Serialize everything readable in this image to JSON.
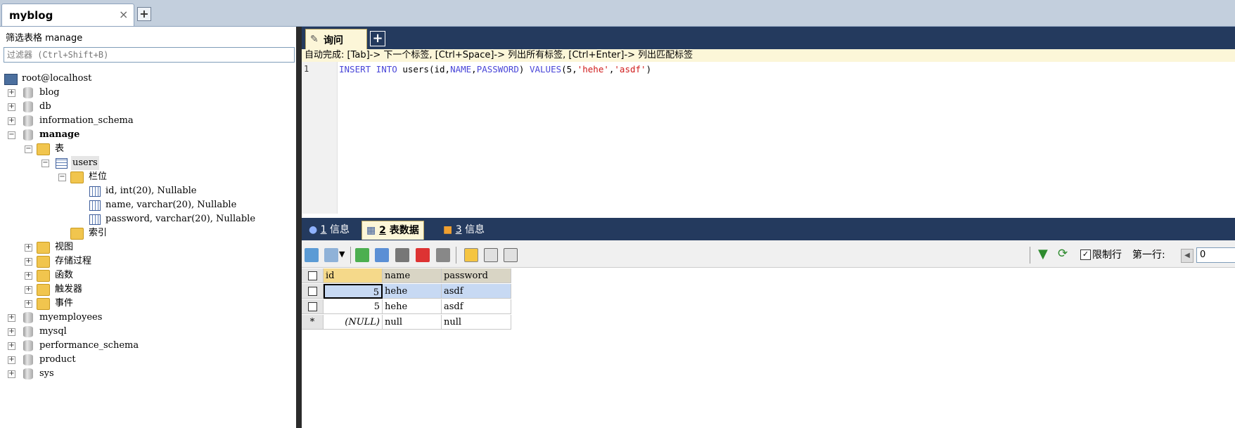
{
  "window": {
    "doc_tab": {
      "label": "myblog",
      "close": "×"
    },
    "new_tab": "+"
  },
  "left_panel": {
    "filter_label": "筛选表格 manage",
    "filter_placeholder": "过滤器 (Ctrl+Shift+B)",
    "host": "root@localhost",
    "databases": [
      "blog",
      "db",
      "information_schema"
    ],
    "active_db": "manage",
    "tables_folder": "表",
    "table": "users",
    "columns_folder": "栏位",
    "columns": [
      "id, int(20), Nullable",
      "name, varchar(20), Nullable",
      "password, varchar(20), Nullable"
    ],
    "index_folder": "索引",
    "other_folders": [
      "视图",
      "存储过程",
      "函数",
      "触发器",
      "事件"
    ],
    "more_databases": [
      "myemployees",
      "mysql",
      "performance_schema",
      "product",
      "sys"
    ]
  },
  "query": {
    "tab_label": "询问",
    "new_tab": "+",
    "autocomplete_hint": "自动完成: [Tab]-> 下一个标签, [Ctrl+Space]-> 列出所有标签, [Ctrl+Enter]-> 列出匹配标签",
    "line_number": "1",
    "sql": {
      "kw1": "INSERT INTO",
      "t1": " users(id,",
      "kw2": "NAME",
      "t2": ",",
      "kw3": "PASSWORD",
      "t3": ") ",
      "kw4": "VALUES",
      "t4": "(5,",
      "s1": "'hehe'",
      "t5": ",",
      "s2": "'asdf'",
      "t6": ")"
    }
  },
  "result_tabs": [
    {
      "num": "1",
      "label": "信息"
    },
    {
      "num": "2",
      "label": "表数据"
    },
    {
      "num": "3",
      "label": "信息"
    }
  ],
  "toolbar": {
    "limit_rows_label": "限制行",
    "limit_checked": "✓",
    "first_row_label": "第一行:",
    "first_row_value": "0"
  },
  "grid": {
    "headers": [
      "id",
      "name",
      "password"
    ],
    "rows": [
      [
        "5",
        "hehe",
        "asdf"
      ],
      [
        "5",
        "hehe",
        "asdf"
      ],
      [
        "(NULL)",
        "null",
        "null"
      ]
    ],
    "new_row_marker": "*"
  }
}
